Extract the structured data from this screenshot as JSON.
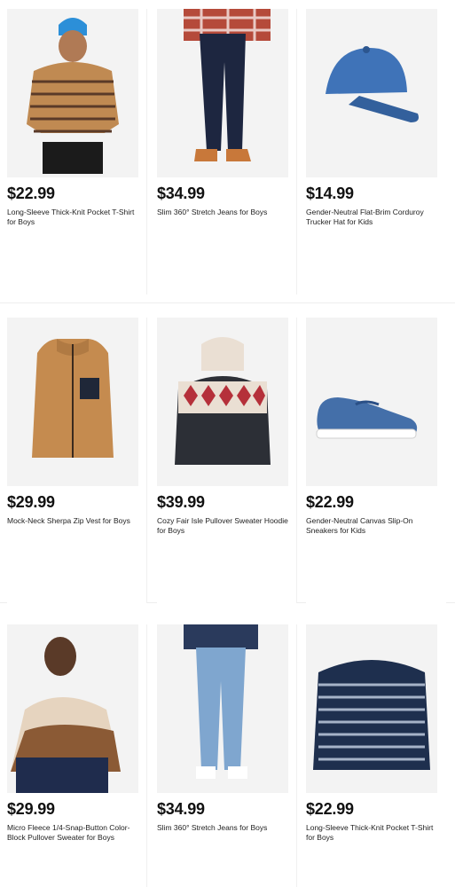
{
  "products": [
    {
      "price": "$22.99",
      "title": "Long-Sleeve Thick-Knit Pocket T-Shirt for Boys"
    },
    {
      "price": "$34.99",
      "title": "Slim 360° Stretch Jeans for Boys"
    },
    {
      "price": "$14.99",
      "title": "Gender-Neutral Flat-Brim Corduroy Trucker Hat for Kids"
    },
    {
      "price": "$29.99",
      "title": "Mock-Neck Sherpa Zip Vest for Boys"
    },
    {
      "price": "$39.99",
      "title": "Cozy Fair Isle Pullover Sweater Hoodie for Boys"
    },
    {
      "price": "$22.99",
      "title": "Gender-Neutral Canvas Slip-On Sneakers for Kids"
    },
    {
      "price": "$29.99",
      "title": "Micro Fleece 1/4-Snap-Button Color-Block Pullover Sweater for Boys"
    },
    {
      "price": "$34.99",
      "title": "Slim 360° Stretch Jeans for Boys"
    },
    {
      "price": "$22.99",
      "title": "Long-Sleeve Thick-Knit Pocket T-Shirt for Boys"
    }
  ]
}
